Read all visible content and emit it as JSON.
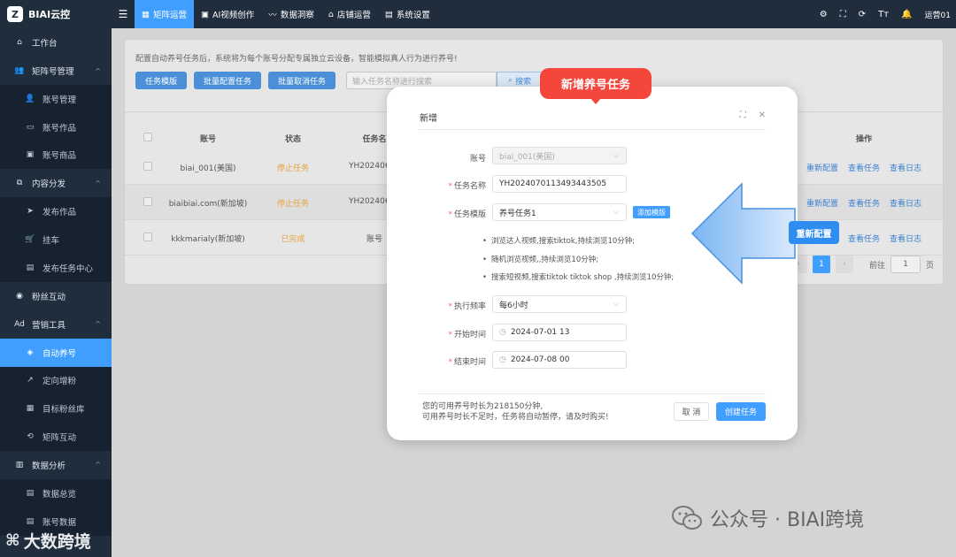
{
  "app": {
    "logo_badge": "Z",
    "name": "BIAI云控"
  },
  "sidebar": {
    "items": [
      {
        "label": "工作台",
        "icon": "home-icon",
        "glyph": "⌂",
        "type": "group",
        "chevron": ""
      },
      {
        "label": "矩阵号管理",
        "icon": "users-icon",
        "glyph": "👥",
        "type": "group",
        "chevron": "^"
      },
      {
        "label": "账号管理",
        "icon": "user-icon",
        "glyph": "👤",
        "type": "sub"
      },
      {
        "label": "账号作品",
        "icon": "works-icon",
        "glyph": "▭",
        "type": "sub"
      },
      {
        "label": "账号商品",
        "icon": "goods-icon",
        "glyph": "▣",
        "type": "sub"
      },
      {
        "label": "内容分发",
        "icon": "distribute-icon",
        "glyph": "⧉",
        "type": "group",
        "chevron": "^"
      },
      {
        "label": "发布作品",
        "icon": "send-icon",
        "glyph": "➤",
        "type": "sub"
      },
      {
        "label": "挂车",
        "icon": "cart-icon",
        "glyph": "🛒",
        "type": "sub"
      },
      {
        "label": "发布任务中心",
        "icon": "task-center-icon",
        "glyph": "▤",
        "type": "sub"
      },
      {
        "label": "粉丝互动",
        "icon": "fans-icon",
        "glyph": "◉",
        "type": "group",
        "chevron": ""
      },
      {
        "label": "营销工具",
        "icon": "ad-icon",
        "glyph": "Ad",
        "type": "group",
        "chevron": "^"
      },
      {
        "label": "自动养号",
        "icon": "android-icon",
        "glyph": "◈",
        "type": "sub",
        "active": true
      },
      {
        "label": "定向增粉",
        "icon": "growth-icon",
        "glyph": "↗",
        "type": "sub"
      },
      {
        "label": "目标粉丝库",
        "icon": "target-icon",
        "glyph": "▦",
        "type": "sub"
      },
      {
        "label": "矩阵互动",
        "icon": "matrix-icon",
        "glyph": "⟲",
        "type": "sub"
      },
      {
        "label": "数据分析",
        "icon": "chart-icon",
        "glyph": "▥",
        "type": "group",
        "chevron": "^"
      },
      {
        "label": "数据总览",
        "icon": "overview-icon",
        "glyph": "▤",
        "type": "sub"
      },
      {
        "label": "账号数据",
        "icon": "account-data-icon",
        "glyph": "▤",
        "type": "sub"
      }
    ]
  },
  "topbar": {
    "tabs": [
      {
        "label": "矩阵运营",
        "icon": "grid-icon",
        "glyph": "▦",
        "active": true
      },
      {
        "label": "AI视频创作",
        "icon": "ai-icon",
        "glyph": "▣"
      },
      {
        "label": "数据洞察",
        "icon": "insight-icon",
        "glyph": "〰"
      },
      {
        "label": "店铺运营",
        "icon": "store-icon",
        "glyph": "⌂"
      },
      {
        "label": "系统设置",
        "icon": "settings-icon",
        "glyph": "▤"
      }
    ],
    "right_icons": [
      {
        "name": "gear-icon",
        "glyph": "⚙"
      },
      {
        "name": "fullscreen-icon",
        "glyph": "⛶"
      },
      {
        "name": "refresh-icon",
        "glyph": "⟳"
      },
      {
        "name": "font-size-icon",
        "glyph": "Tт"
      },
      {
        "name": "bell-icon",
        "glyph": "🔔"
      }
    ],
    "user": "运营01"
  },
  "toolbar": {
    "notice": "配置自动养号任务后，系统将为每个账号分配专属独立云设备，智能模拟真人行为进行养号!",
    "buttons": [
      "任务模版",
      "批量配置任务",
      "批量取消任务"
    ],
    "search_placeholder": "输入任务名称进行搜索",
    "search_button": "搜索"
  },
  "table": {
    "headers": [
      "账号",
      "状态",
      "任务名",
      "操作"
    ],
    "rows": [
      {
        "account": "biai_001(美国)",
        "status": "停止任务",
        "task": "YH20240604",
        "status_class": "st-orange"
      },
      {
        "account": "biaibiai.com(新加坡)",
        "status": "停止任务",
        "task": "YH20240604",
        "status_class": "st-orange"
      },
      {
        "account": "kkkmarialy(新加坡)",
        "status": "已完成",
        "task": "账号",
        "status_class": "st-orange"
      }
    ],
    "actions": [
      "重新配置",
      "查看任务",
      "查看日志"
    ],
    "pagination": {
      "current": "1",
      "goto_label": "前往",
      "goto_value": "1",
      "page_unit": "页",
      "prev": "‹",
      "next": "›"
    }
  },
  "modal": {
    "title": "新增",
    "icons": {
      "maximize": "⛶",
      "close": "✕"
    },
    "fields": {
      "account": {
        "label": "账号",
        "value": "biai_001(美国)"
      },
      "task_name": {
        "label": "任务名称",
        "value": "YH2024070113493443505"
      },
      "template": {
        "label": "任务模版",
        "value": "养号任务1",
        "add_button": "添加模版"
      },
      "frequency": {
        "label": "执行频率",
        "value": "每6小时"
      },
      "start_time": {
        "label": "开始时间",
        "value": "2024-07-01 13"
      },
      "end_time": {
        "label": "结束时间",
        "value": "2024-07-08 00"
      }
    },
    "template_steps": [
      "浏览达人视频,搜索tiktok,持续浏览10分钟;",
      "随机浏览视频,,持续浏览10分钟;",
      "搜索短视频,搜索tiktok tiktok shop ,持续浏览10分钟;"
    ],
    "footer": {
      "line1": "您的可用养号时长为218150分钟,",
      "line2": "可用养号时长不足时，任务将自动暂停，请及时购买!",
      "cancel": "取 消",
      "confirm": "创建任务"
    }
  },
  "annotations": {
    "red_callout": "新增养号任务",
    "blue_callout": "重新配置"
  },
  "watermarks": {
    "wechat": "公众号 · BIAI跨境",
    "bottom": "大数跨境"
  },
  "colors": {
    "sidebar_bg": "#1f2d3d",
    "accent": "#409eff",
    "callout_red": "#f5463c",
    "status_orange": "#e6a23c"
  }
}
